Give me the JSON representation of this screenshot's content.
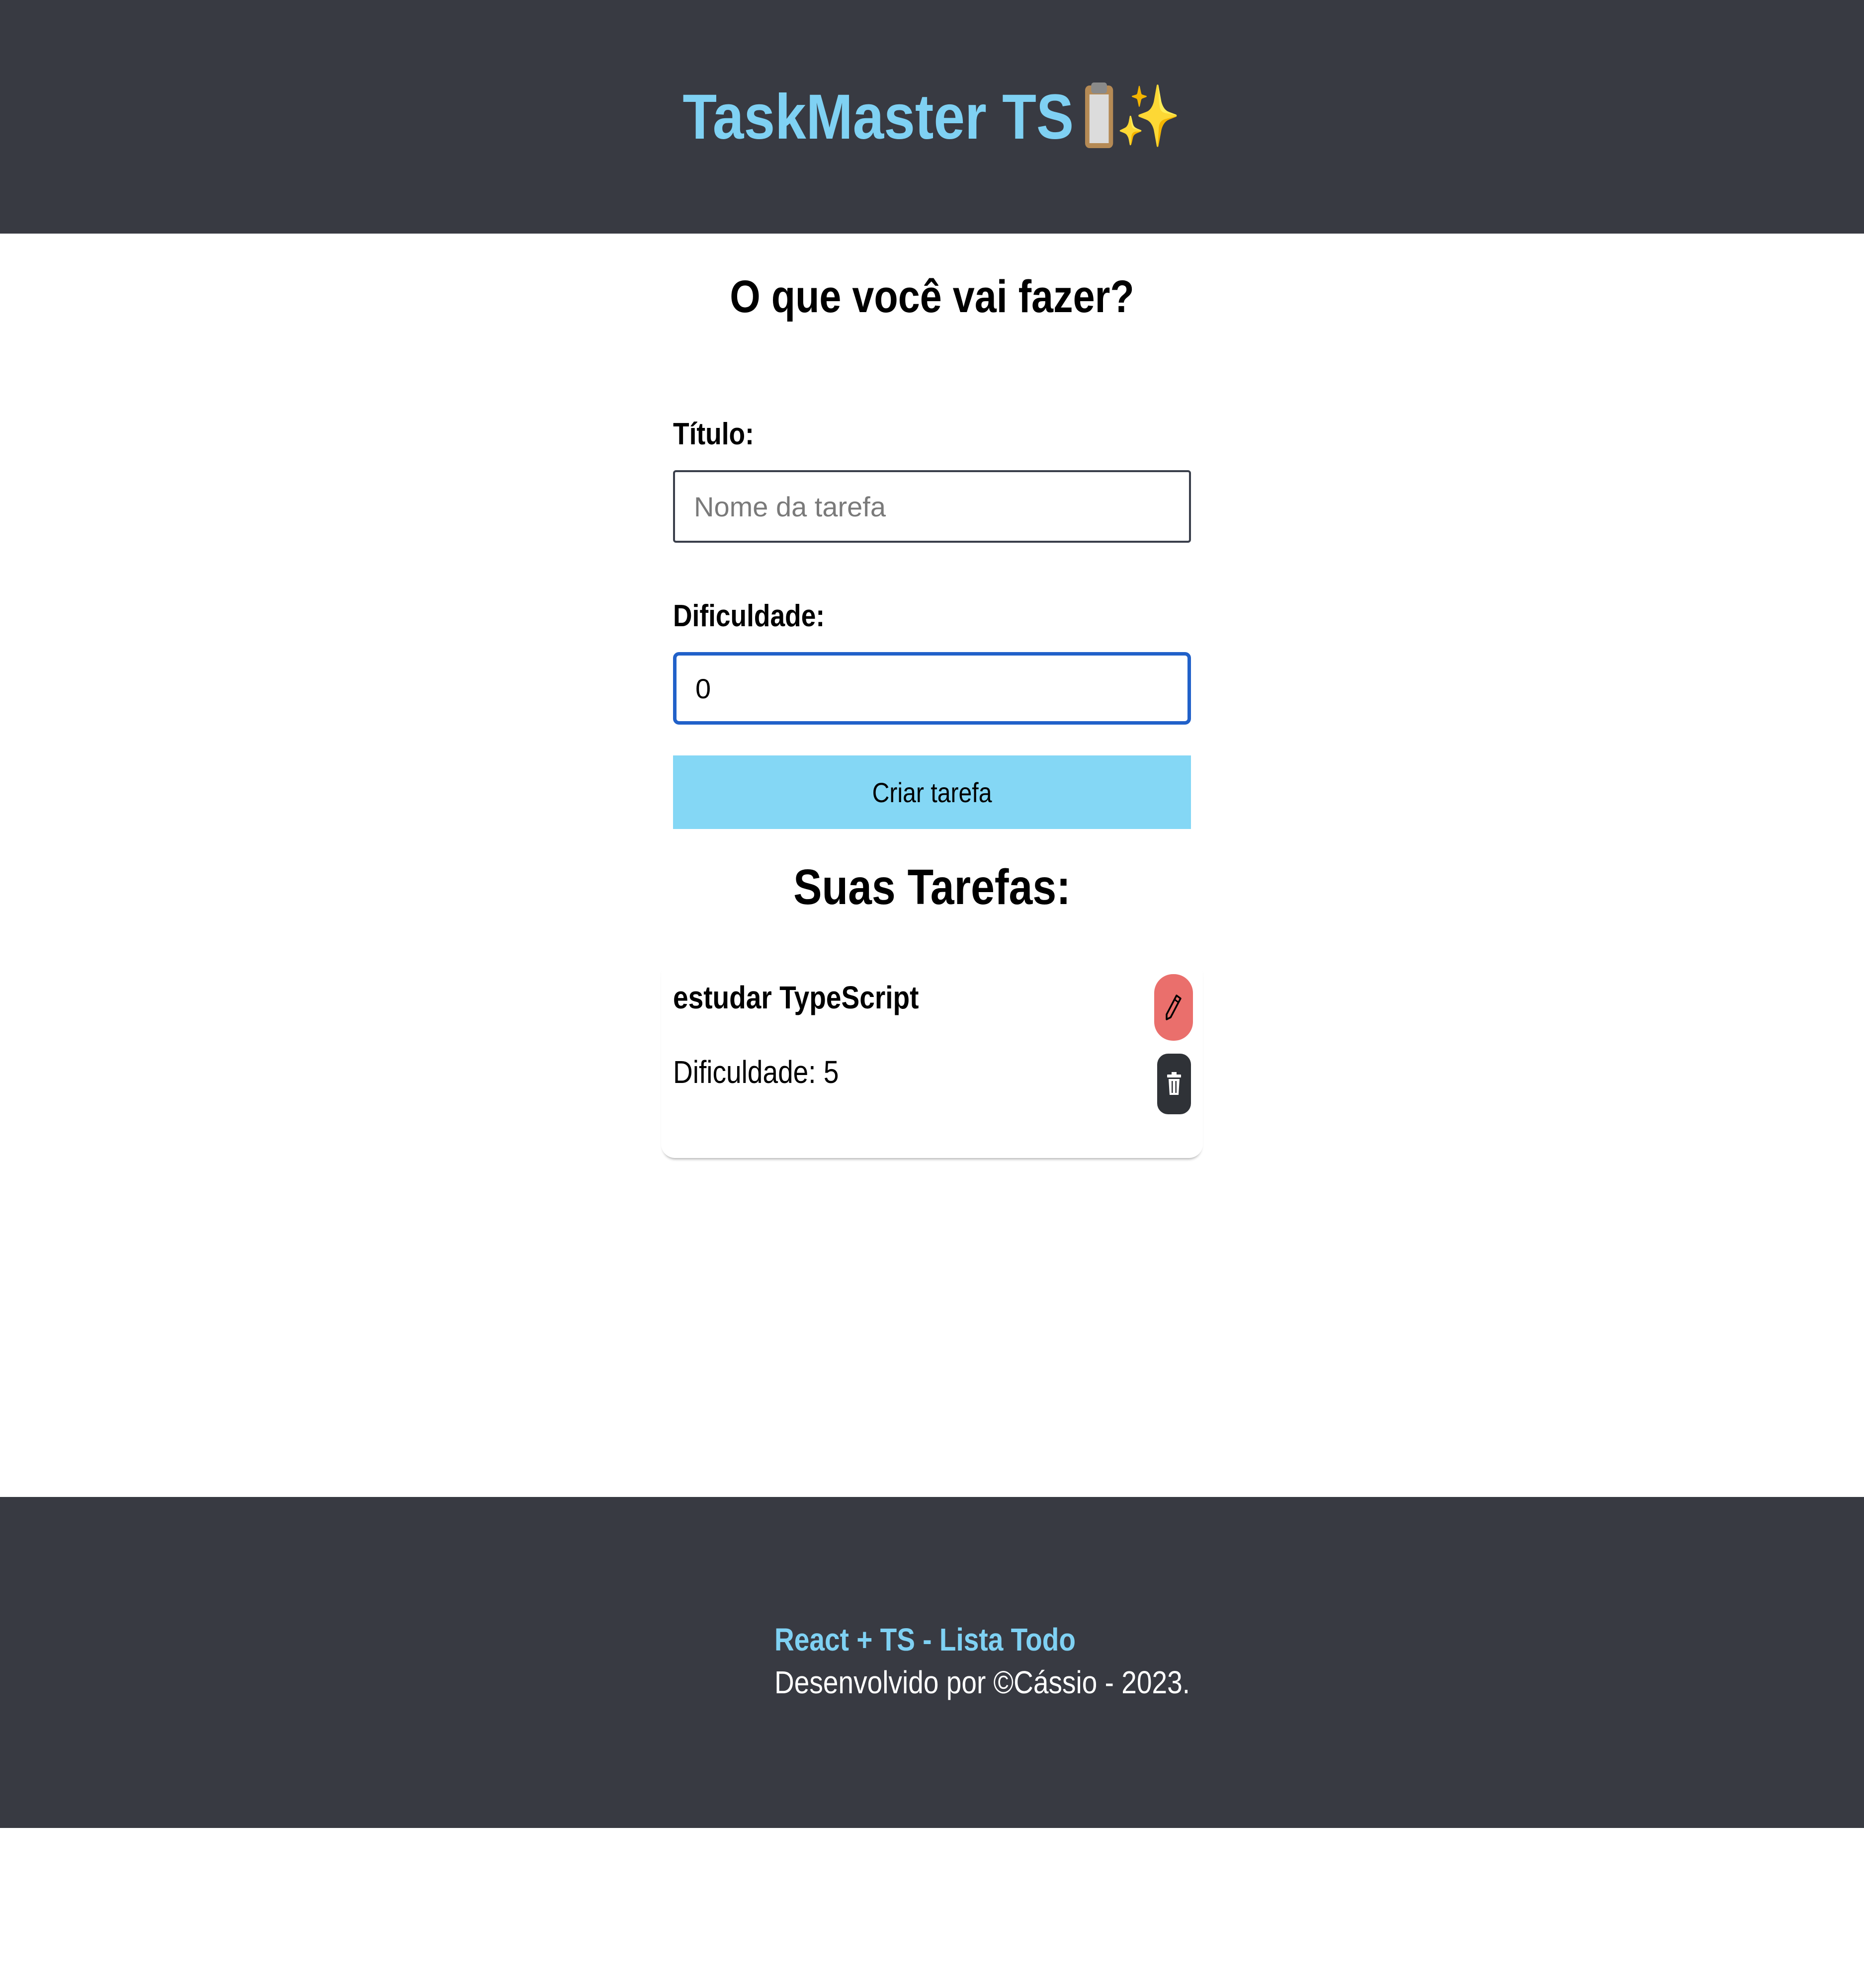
{
  "header": {
    "title": "TaskMaster TS",
    "emoji": [
      "clipboard-icon",
      "sparkles-icon"
    ]
  },
  "form": {
    "heading": "O que você vai fazer?",
    "title_label": "Título:",
    "title_placeholder": "Nome da tarefa",
    "title_value": "",
    "difficulty_label": "Dificuldade:",
    "difficulty_value": "0",
    "submit_label": "Criar tarefa"
  },
  "tasks": {
    "heading": "Suas Tarefas:",
    "items": [
      {
        "title": "estudar TypeScript",
        "difficulty": "Dificuldade: 5",
        "edit_icon": "pencil-icon",
        "delete_icon": "trash-icon"
      }
    ]
  },
  "footer": {
    "title": "React + TS - Lista Todo",
    "credit": "Desenvolvido por ©Cássio - 2023."
  },
  "colors": {
    "header_bg": "#383a42",
    "accent": "#7fd1f3",
    "button_bg": "#84d7f5",
    "edit_bg": "#ea6f6c",
    "delete_bg": "#2f3237",
    "focus_border": "#2161c9"
  }
}
